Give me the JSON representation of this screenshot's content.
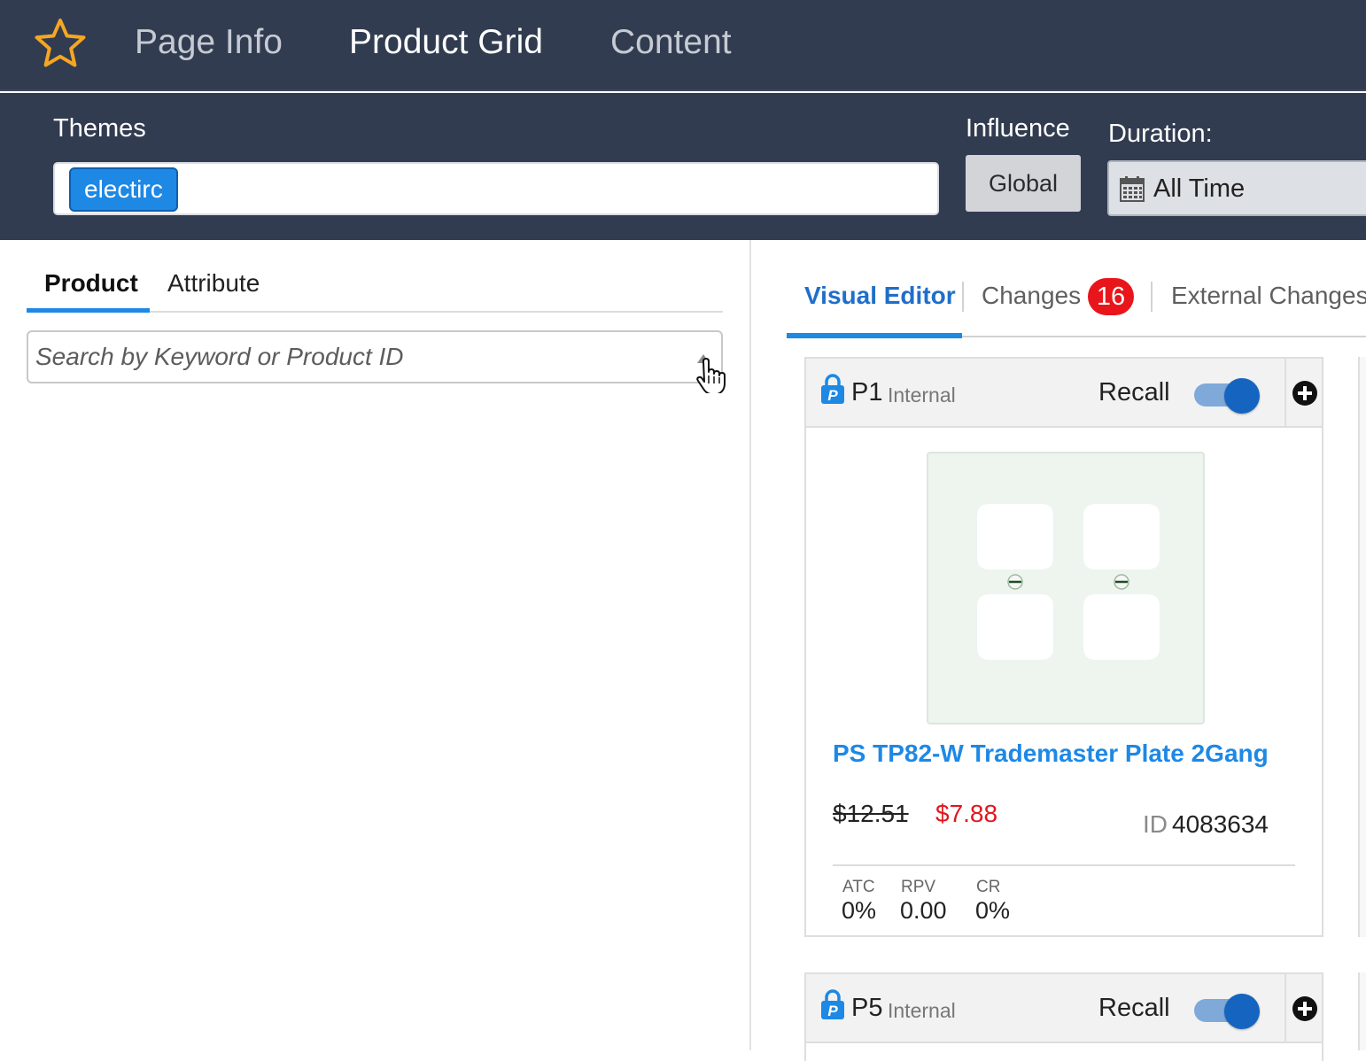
{
  "nav": {
    "tabs": [
      {
        "label": "Page Info"
      },
      {
        "label": "Product Grid"
      },
      {
        "label": "Content"
      }
    ]
  },
  "filters": {
    "themes_label": "Themes",
    "theme_tags": [
      "electirc"
    ],
    "influence_label": "Influence",
    "influence_value": "Global",
    "duration_label": "Duration:",
    "duration_value": "All Time"
  },
  "left_panel": {
    "tabs": [
      {
        "label": "Product"
      },
      {
        "label": "Attribute"
      }
    ],
    "search_placeholder": "Search by Keyword or Product ID"
  },
  "right_panel": {
    "tabs": [
      {
        "label": "Visual Editor"
      },
      {
        "label": "Changes"
      },
      {
        "label": "External Changes"
      }
    ],
    "changes_count": "16"
  },
  "products": [
    {
      "position": "P1",
      "type": "Internal",
      "recall_label": "Recall",
      "recall_on": true,
      "name": "PS TP82-W Trademaster Plate 2Gang",
      "price_old": "$12.51",
      "price_new": "$7.88",
      "id_label": "ID",
      "id_value": "4083634",
      "metrics": [
        {
          "label": "ATC",
          "value": "0%"
        },
        {
          "label": "RPV",
          "value": "0.00"
        },
        {
          "label": "CR",
          "value": "0%"
        }
      ]
    },
    {
      "position": "P5",
      "type": "Internal",
      "recall_label": "Recall",
      "recall_on": true
    }
  ],
  "colors": {
    "nav_bg": "#323c50",
    "accent": "#1e88e5",
    "badge_red": "#e8151b",
    "sale_red": "#e0161c",
    "star": "#f5a623"
  }
}
